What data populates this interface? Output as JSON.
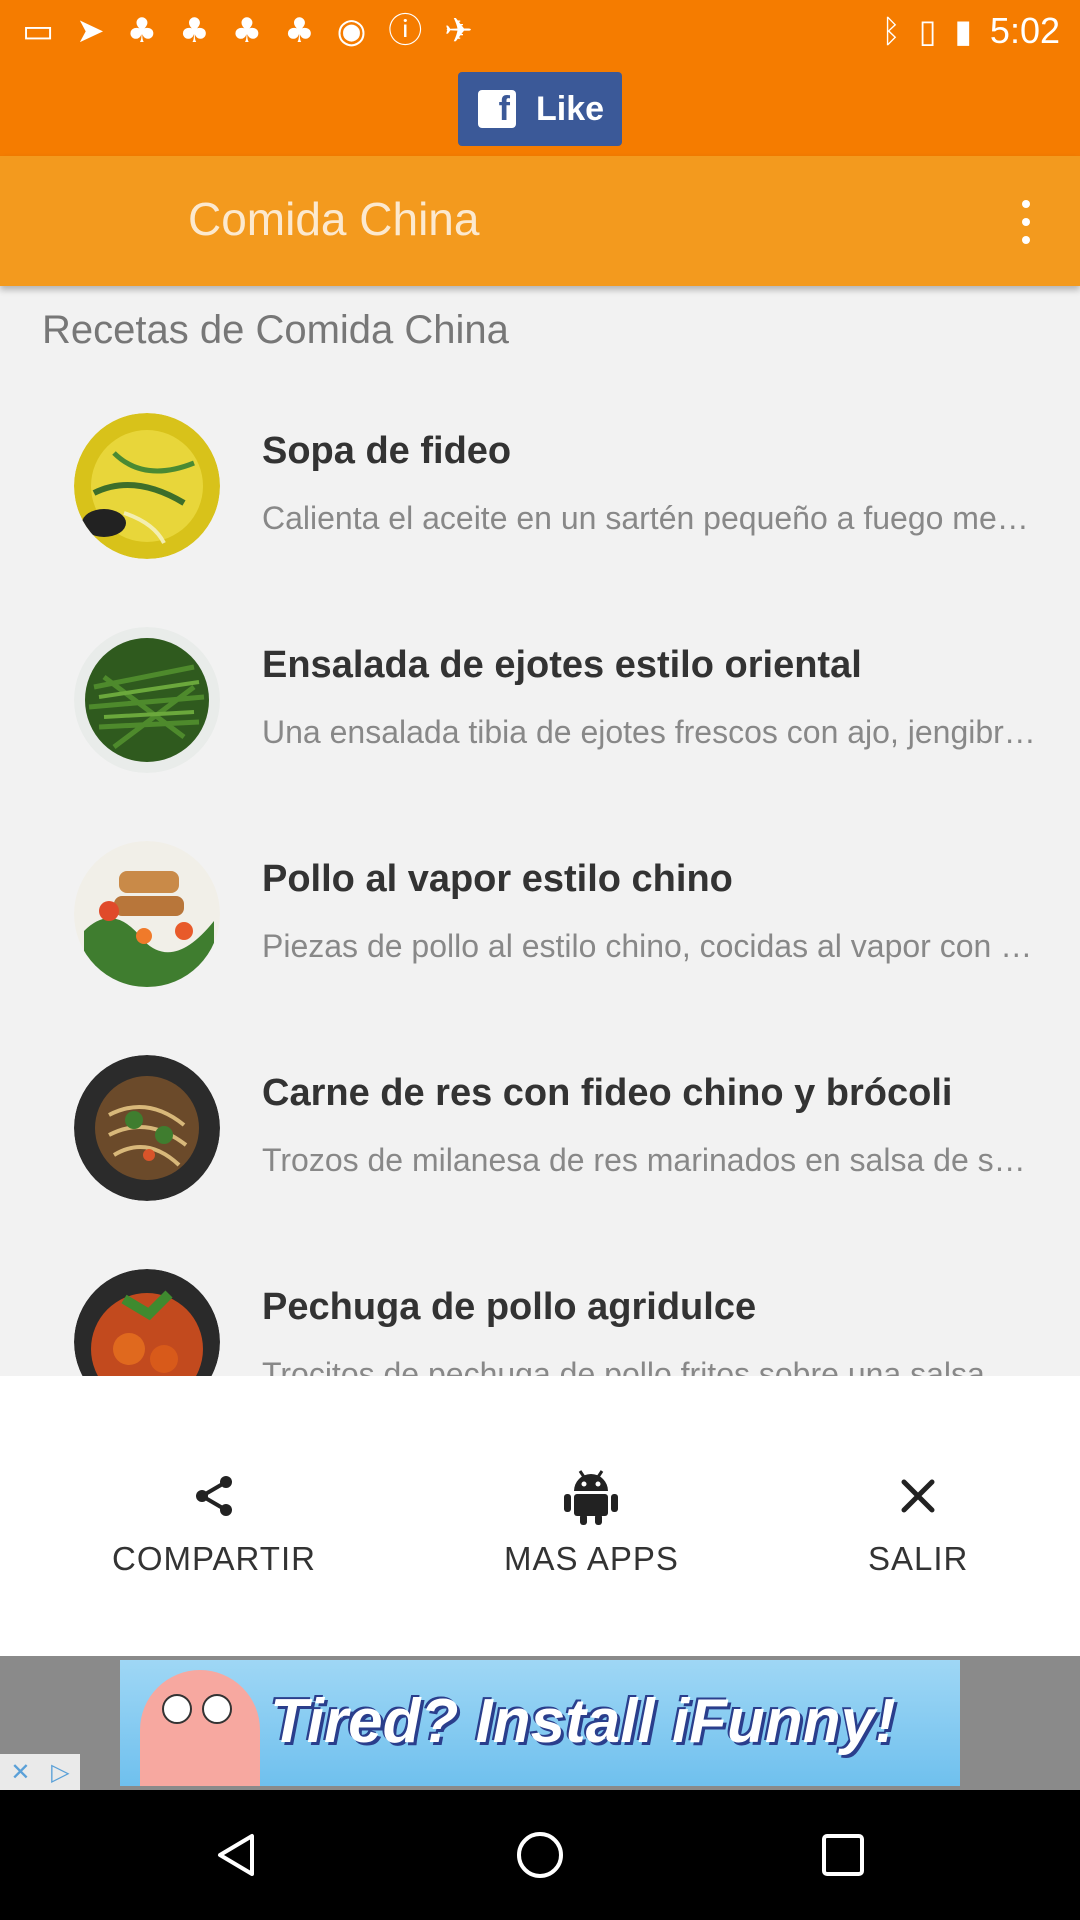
{
  "status_bar": {
    "left_icons": [
      "chat-icon",
      "send-icon",
      "tree-icon",
      "tree-icon",
      "tree-icon",
      "tree-icon",
      "record-icon",
      "info-icon",
      "satellite-icon"
    ],
    "right_icons": [
      "bluetooth-icon",
      "vibrate-icon",
      "battery-icon"
    ],
    "time": "5:02"
  },
  "facebook": {
    "like_label": "Like",
    "logo": "f"
  },
  "app_bar": {
    "title": "Comida China"
  },
  "section_title": "Recetas de Comida China",
  "recipes": [
    {
      "title": "Sopa de fideo",
      "description": "Calienta el aceite en un sartén pequeño a fuego medio."
    },
    {
      "title": "Ensalada de ejotes estilo oriental",
      "description": "Una ensalada tibia de ejotes frescos con ajo, jengibre y salsa de soya."
    },
    {
      "title": "Pollo al vapor estilo chino",
      "description": "Piezas de pollo al estilo chino, cocidas al vapor con verduras."
    },
    {
      "title": "Carne de res con fideo chino y brócoli",
      "description": "Trozos de milanesa de res marinados en salsa de soya."
    },
    {
      "title": "Pechuga de pollo agridulce",
      "description": "Trocitos de pechuga de pollo fritos sobre una salsa agridulce."
    }
  ],
  "actions": {
    "share": "COMPARTIR",
    "more_apps": "MAS APPS",
    "exit": "SALIR"
  },
  "ad": {
    "text": "Tired? Install iFunny!"
  },
  "colors": {
    "primary": "#f39a1e",
    "status": "#f57c00",
    "facebook": "#3b5998"
  }
}
